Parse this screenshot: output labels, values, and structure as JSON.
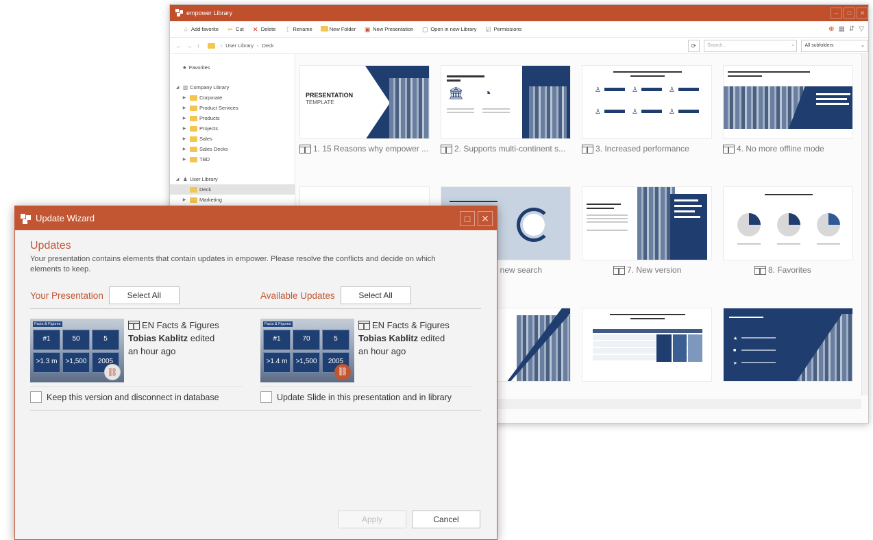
{
  "library": {
    "title": "empower Library",
    "toolbar": [
      "Add favorite",
      "Cut",
      "Delete",
      "Rename",
      "New Folder",
      "New Presentation",
      "Open in new Library",
      "Permissions"
    ],
    "breadcrumb": [
      "User Library",
      "Deck"
    ],
    "search_placeholder": "Search...",
    "subfolders_label": "All subfolders",
    "tree": {
      "favorites": "Favorites",
      "company_library": "Company Library",
      "company_children": [
        "Corporate",
        "Product Services",
        "Products",
        "Projects",
        "Sales",
        "Sales Decks",
        "TBD"
      ],
      "user_library": "User Library",
      "user_children": [
        "Deck",
        "Marketing"
      ]
    },
    "thumbs": [
      {
        "label": "1. 15 Reasons why empower ...",
        "slide_title": "PRESENTATION",
        "slide_sub": "TEMPLATE"
      },
      {
        "label": "2. Supports multi-continent s..."
      },
      {
        "label": "3. Increased performance"
      },
      {
        "label": "4. No more offline mode"
      },
      {
        "label": "ll new search"
      },
      {
        "label": "7. New version"
      },
      {
        "label": "8. Favorites"
      }
    ]
  },
  "wizard": {
    "title": "Update Wizard",
    "heading": "Updates",
    "description": "Your presentation contains elements that contain updates in empower. Please resolve the conflicts and decide on which elements to keep.",
    "left": {
      "label": "Your Presentation",
      "select_all": "Select All",
      "file": "EN Facts & Figures",
      "author": "Tobias Kablitz",
      "action": "edited",
      "time": "an hour ago",
      "tiles": [
        "#1",
        "50",
        "5",
        ">1.3 m",
        ">1,500",
        "2005"
      ],
      "header": "Facts & Figures",
      "checkbox": "Keep this version and disconnect in database"
    },
    "right": {
      "label": "Available Updates",
      "select_all": "Select All",
      "file": "EN Facts & Figures",
      "author": "Tobias Kablitz",
      "action": "edited",
      "time": "an hour ago",
      "tiles": [
        "#1",
        "70",
        "5",
        ">1.4 m",
        ">1,500",
        "2005"
      ],
      "header": "Facts & Figures",
      "checkbox": "Update Slide in this presentation and in library"
    },
    "apply": "Apply",
    "cancel": "Cancel"
  },
  "colors": {
    "accent": "#c25532",
    "navy": "#1f3d6e"
  }
}
